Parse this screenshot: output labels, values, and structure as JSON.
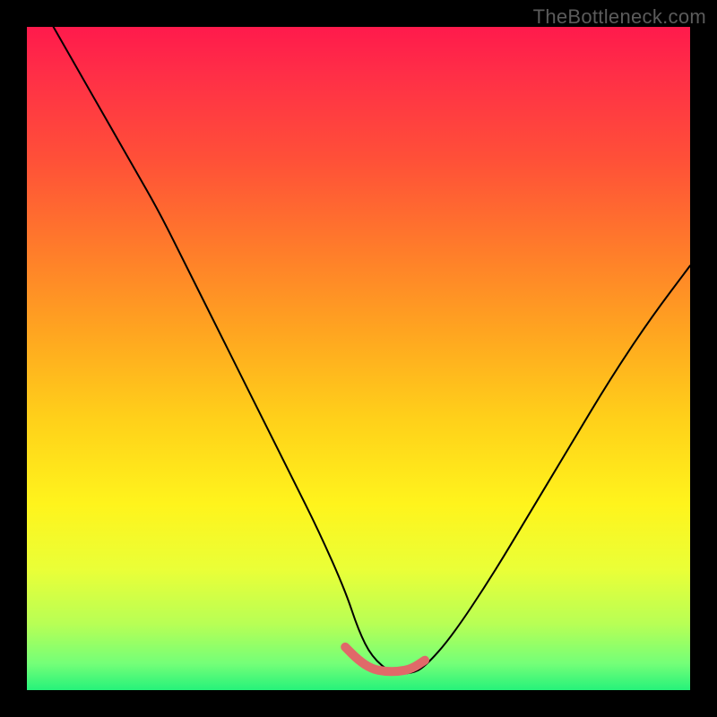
{
  "watermark": "TheBottleneck.com",
  "chart_data": {
    "type": "line",
    "title": "",
    "xlabel": "",
    "ylabel": "",
    "xlim": [
      0,
      100
    ],
    "ylim": [
      0,
      100
    ],
    "grid": false,
    "legend": false,
    "series": [
      {
        "name": "bottleneck-curve",
        "color": "#000000",
        "x": [
          4,
          8,
          12,
          16,
          20,
          24,
          28,
          32,
          36,
          40,
          44,
          48,
          50,
          52,
          55,
          58,
          60,
          64,
          70,
          76,
          82,
          88,
          94,
          100
        ],
        "y": [
          100,
          93,
          86,
          79,
          72,
          64,
          56,
          48,
          40,
          32,
          24,
          15,
          9,
          5,
          2.5,
          2.5,
          3.5,
          8,
          17,
          27,
          37,
          47,
          56,
          64
        ]
      },
      {
        "name": "optimal-band",
        "color": "#e06969",
        "x": [
          48,
          50,
          52,
          54,
          56,
          58,
          60
        ],
        "y": [
          6.5,
          4.5,
          3.2,
          2.8,
          2.8,
          3.2,
          4.5
        ]
      }
    ],
    "background_gradient": {
      "stops": [
        {
          "pos": 0.0,
          "color": "#ff1a4c"
        },
        {
          "pos": 0.07,
          "color": "#ff2e47"
        },
        {
          "pos": 0.2,
          "color": "#ff5038"
        },
        {
          "pos": 0.33,
          "color": "#ff7a2b"
        },
        {
          "pos": 0.46,
          "color": "#ffa520"
        },
        {
          "pos": 0.59,
          "color": "#ffd01a"
        },
        {
          "pos": 0.72,
          "color": "#fff41c"
        },
        {
          "pos": 0.82,
          "color": "#e9ff38"
        },
        {
          "pos": 0.9,
          "color": "#b8ff55"
        },
        {
          "pos": 0.96,
          "color": "#74ff78"
        },
        {
          "pos": 1.0,
          "color": "#26f27a"
        }
      ]
    }
  }
}
